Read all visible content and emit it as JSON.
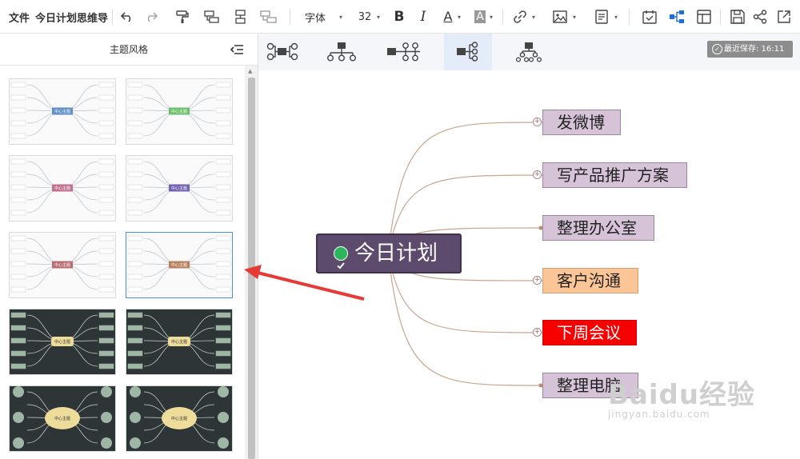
{
  "toolbar": {
    "file_menu": "文件",
    "doc_title": "今日计划思维导",
    "font_name": "字体",
    "font_size": "32",
    "bold_label": "B",
    "italic_label": "I",
    "font_color_label": "A",
    "highlight_label": "A",
    "accent_color": "#1e6fd9"
  },
  "panel": {
    "title": "主题风格",
    "themes": [
      {
        "style": "light",
        "center_color": "#5f8fc4",
        "center_label": "中心主题"
      },
      {
        "style": "light",
        "center_color": "#6cc06a",
        "center_label": "中心主题"
      },
      {
        "style": "light",
        "center_color": "#c0708e",
        "center_label": "中心主题"
      },
      {
        "style": "light",
        "center_color": "#7461b0",
        "center_label": "中心主题"
      },
      {
        "style": "light",
        "center_color": "#b86d72",
        "center_label": "中心主题"
      },
      {
        "style": "light",
        "center_color": "#b8805d",
        "center_label": "中心主题",
        "selected": true
      },
      {
        "style": "dark",
        "center_color": "#eddc9a",
        "center_label": "中心主题"
      },
      {
        "style": "dark",
        "center_color": "#eddc9a",
        "center_label": "中心主题"
      },
      {
        "style": "dark-circle",
        "center_color": "#eddc9a",
        "center_label": "中心主题"
      },
      {
        "style": "dark-circle",
        "center_color": "#eddc9a",
        "center_label": "中心主题"
      }
    ]
  },
  "canvas": {
    "save_status": "最近保存: 16:11",
    "layouts": [
      "logic-left-right",
      "org-chart-down",
      "timeline",
      "logic-right",
      "tree-down"
    ],
    "active_layout": 3
  },
  "mindmap": {
    "root": "今日计划",
    "branches": [
      {
        "label": "发微博",
        "style": "purple",
        "collapsed": true
      },
      {
        "label": "写产品推广方案",
        "style": "purple",
        "collapsed": true
      },
      {
        "label": "整理办公室",
        "style": "purple",
        "collapsed": false
      },
      {
        "label": "客户沟通",
        "style": "orange",
        "collapsed": true
      },
      {
        "label": "下周会议",
        "style": "red",
        "collapsed": true
      },
      {
        "label": "整理电脑",
        "style": "purple",
        "collapsed": false
      }
    ],
    "line_color": "#c8a590"
  },
  "watermark": {
    "main": "Baidu经验",
    "sub": "jingyan.baidu.com"
  }
}
